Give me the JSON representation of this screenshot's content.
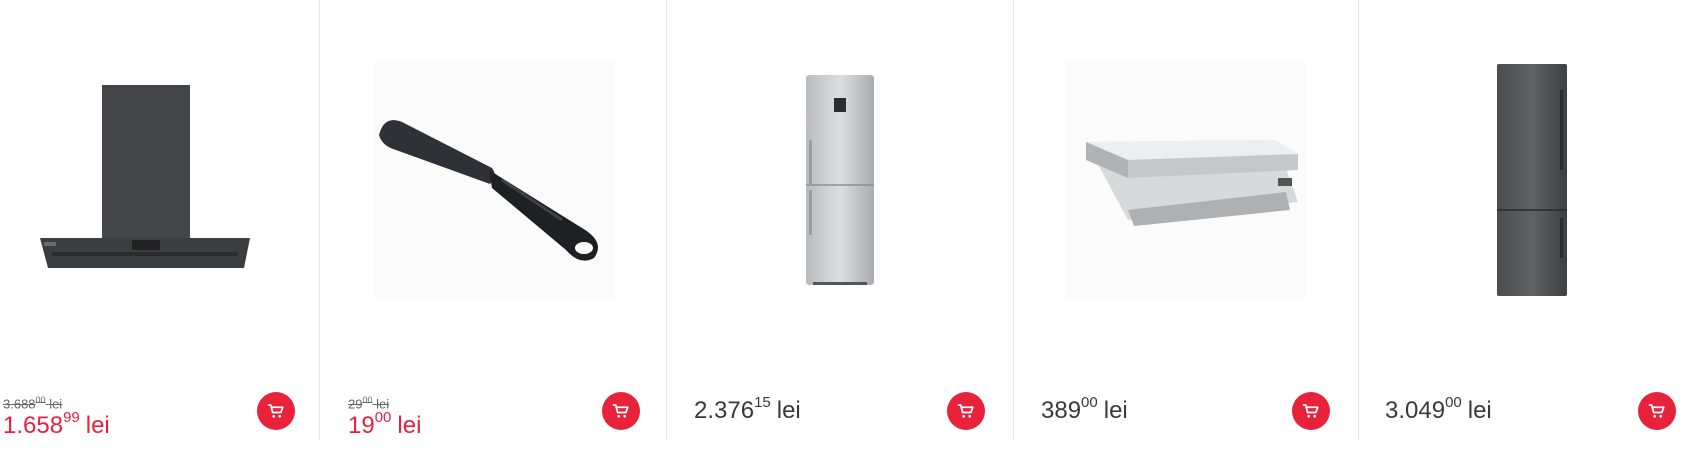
{
  "products": [
    {
      "image": "range-hood-island-black",
      "old_price": {
        "int": "3.688",
        "dec": "00",
        "currency": "lei"
      },
      "price": {
        "int": "1.658",
        "dec": "99",
        "currency": "lei"
      },
      "on_sale": true
    },
    {
      "image": "spatula-black",
      "old_price": {
        "int": "29",
        "dec": "00",
        "currency": "lei"
      },
      "price": {
        "int": "19",
        "dec": "00",
        "currency": "lei"
      },
      "on_sale": true
    },
    {
      "image": "fridge-silver",
      "price": {
        "int": "2.376",
        "dec": "15",
        "currency": "lei"
      },
      "on_sale": false
    },
    {
      "image": "range-hood-telescopic-inox",
      "price": {
        "int": "389",
        "dec": "00",
        "currency": "lei"
      },
      "on_sale": false
    },
    {
      "image": "fridge-dark-inox",
      "price": {
        "int": "3.049",
        "dec": "00",
        "currency": "lei"
      },
      "on_sale": false
    }
  ],
  "colors": {
    "accent": "#e8223b",
    "text": "#3a3a3a",
    "divider": "#e6e6e6"
  },
  "icons": {
    "cart": "cart-icon"
  }
}
